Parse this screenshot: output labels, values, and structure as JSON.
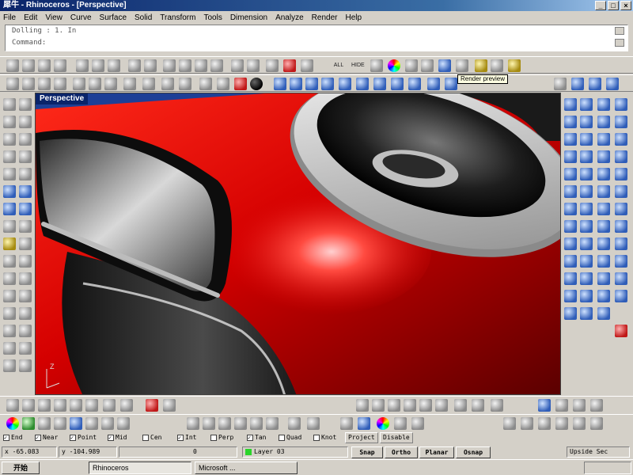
{
  "window": {
    "title": "犀牛 - Rhinoceros - [Perspective]",
    "controls": [
      "_",
      "□",
      "×"
    ]
  },
  "menu": [
    "File",
    "Edit",
    "View",
    "Curve",
    "Surface",
    "Solid",
    "Transform",
    "Tools",
    "Dimension",
    "Analyze",
    "Render",
    "Help"
  ],
  "command_area": {
    "history_line": "Dolling : 1. In",
    "prompt_line": "Command:"
  },
  "toolbar": {
    "tooltip": "Render preview",
    "labels": [
      "ALL",
      "HIDE"
    ]
  },
  "viewport": {
    "label": "Perspective",
    "axis_label": "Z",
    "colors": {
      "background": "#1d3f96",
      "body_red": "#d40000",
      "grid_line": "#3fcf3f"
    }
  },
  "osnap": {
    "items": [
      {
        "label": "End",
        "checked": true
      },
      {
        "label": "Near",
        "checked": true
      },
      {
        "label": "Point",
        "checked": true
      },
      {
        "label": "Mid",
        "checked": true
      },
      {
        "label": "Cen",
        "checked": false
      },
      {
        "label": "Int",
        "checked": true
      },
      {
        "label": "Perp",
        "checked": false
      },
      {
        "label": "Tan",
        "checked": true
      },
      {
        "label": "Quad",
        "checked": false
      },
      {
        "label": "Knot",
        "checked": false
      }
    ],
    "tabs": [
      "Project",
      "Disable"
    ]
  },
  "status": {
    "x": "x -65.083",
    "y": "y -104.989",
    "z": "0",
    "layer": "Layer 03",
    "panes": [
      "Snap",
      "Ortho",
      "Planar",
      "Osnap"
    ],
    "right_info": "Upside Sec"
  },
  "taskbar": {
    "start": "开始",
    "tasks": [
      "Rhinoceros",
      "Microsoft ..."
    ],
    "clock": ""
  }
}
